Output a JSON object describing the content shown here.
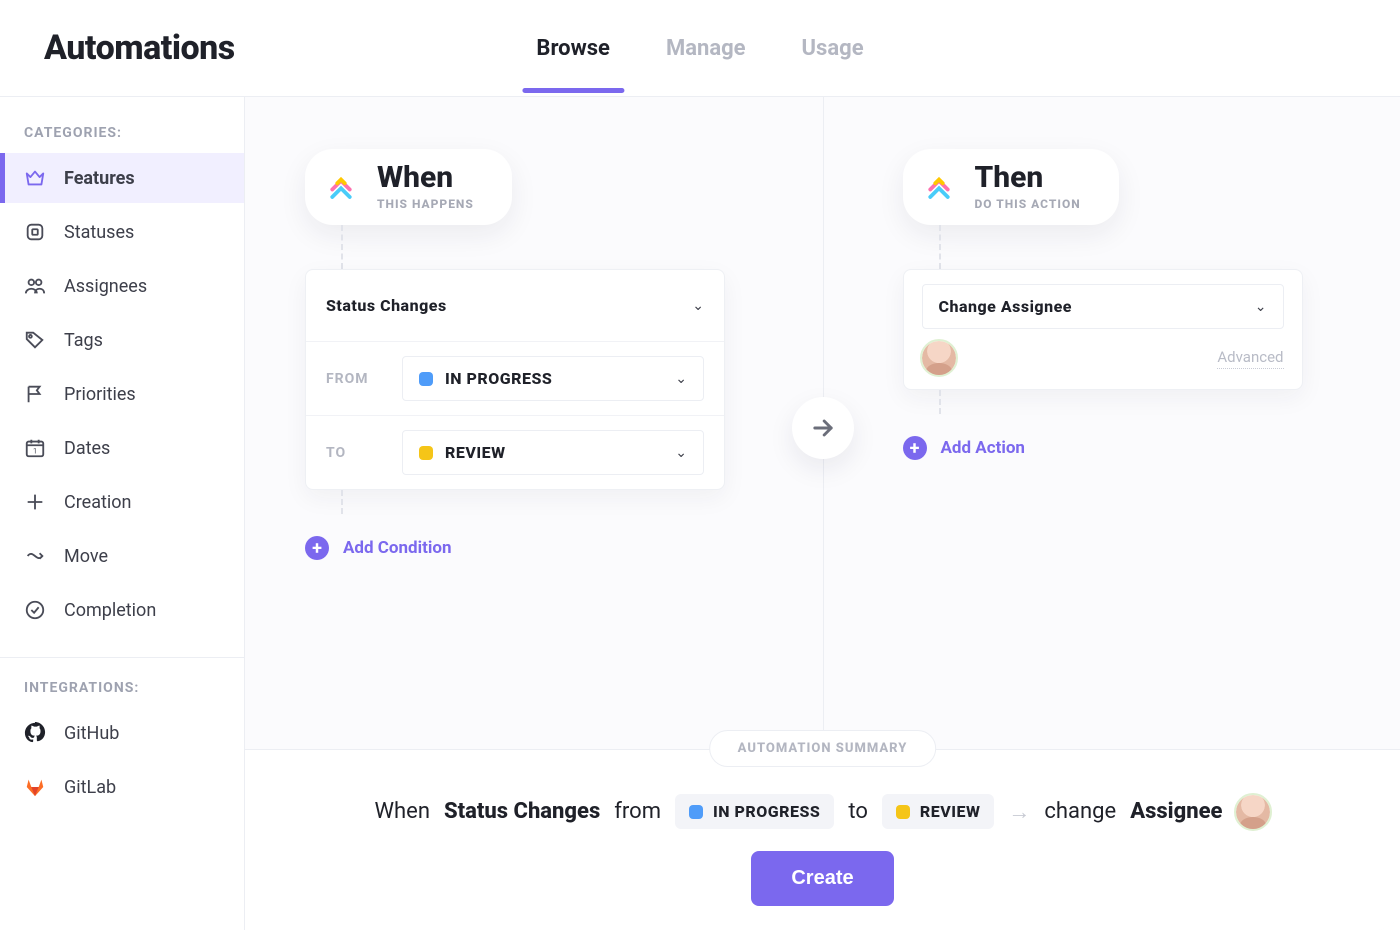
{
  "header": {
    "title": "Automations",
    "tabs": [
      {
        "label": "Browse",
        "active": true
      },
      {
        "label": "Manage",
        "active": false
      },
      {
        "label": "Usage",
        "active": false
      }
    ]
  },
  "sidebar": {
    "categories_label": "CATEGORIES:",
    "categories": [
      {
        "id": "features",
        "label": "Features",
        "active": true
      },
      {
        "id": "statuses",
        "label": "Statuses",
        "active": false
      },
      {
        "id": "assignees",
        "label": "Assignees",
        "active": false
      },
      {
        "id": "tags",
        "label": "Tags",
        "active": false
      },
      {
        "id": "priorities",
        "label": "Priorities",
        "active": false
      },
      {
        "id": "dates",
        "label": "Dates",
        "active": false
      },
      {
        "id": "creation",
        "label": "Creation",
        "active": false
      },
      {
        "id": "move",
        "label": "Move",
        "active": false
      },
      {
        "id": "completion",
        "label": "Completion",
        "active": false
      }
    ],
    "integrations_label": "INTEGRATIONS:",
    "integrations": [
      {
        "id": "github",
        "label": "GitHub"
      },
      {
        "id": "gitlab",
        "label": "GitLab"
      }
    ]
  },
  "builder": {
    "when": {
      "heading": "When",
      "sub": "THIS HAPPENS",
      "trigger": "Status Changes",
      "from_label": "FROM",
      "from_status": {
        "name": "IN PROGRESS",
        "color": "#4f9cf9"
      },
      "to_label": "TO",
      "to_status": {
        "name": "REVIEW",
        "color": "#f5c518"
      },
      "add_condition": "Add Condition"
    },
    "then": {
      "heading": "Then",
      "sub": "DO THIS ACTION",
      "action": "Change Assignee",
      "advanced": "Advanced",
      "add_action": "Add Action"
    }
  },
  "summary": {
    "pill": "AUTOMATION SUMMARY",
    "parts": {
      "when": "When",
      "trigger": "Status Changes",
      "from_word": "from",
      "from_status": "IN PROGRESS",
      "to_word": "to",
      "to_status": "REVIEW",
      "change_word": "change",
      "assignee_word": "Assignee"
    },
    "create": "Create",
    "colors": {
      "in_progress": "#4f9cf9",
      "review": "#f5c518"
    }
  }
}
